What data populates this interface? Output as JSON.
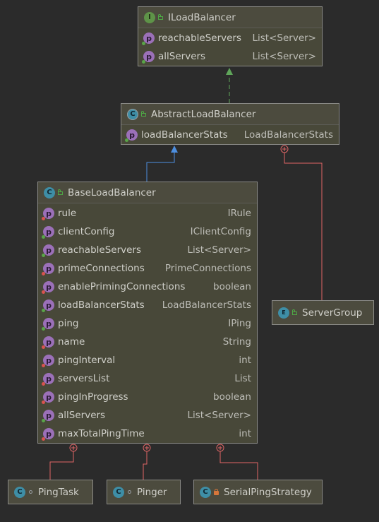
{
  "colors": {
    "background": "#2b2b2b",
    "header": "#4c4b3e",
    "implements_edge": "#5fa55a",
    "extends_edge": "#4d8fe0",
    "inner_edge": "#e06666"
  },
  "boxes": {
    "iloadbalancer": {
      "kind": "interface",
      "icon_letter": "I",
      "visibility": "public",
      "name": "ILoadBalancer",
      "fields": [
        {
          "name": "reachableServers",
          "type": "List<Server>"
        },
        {
          "name": "allServers",
          "type": "List<Server>"
        }
      ]
    },
    "abstractloadbalancer": {
      "kind": "abstract-class",
      "icon_letter": "C",
      "visibility": "public",
      "name": "AbstractLoadBalancer",
      "fields": [
        {
          "name": "loadBalancerStats",
          "type": "LoadBalancerStats"
        }
      ]
    },
    "baseloadbalancer": {
      "kind": "class",
      "icon_letter": "C",
      "visibility": "public",
      "name": "BaseLoadBalancer",
      "fields": [
        {
          "name": "rule",
          "type": "IRule"
        },
        {
          "name": "clientConfig",
          "type": "IClientConfig"
        },
        {
          "name": "reachableServers",
          "type": "List<Server>"
        },
        {
          "name": "primeConnections",
          "type": "PrimeConnections"
        },
        {
          "name": "enablePrimingConnections",
          "type": "boolean"
        },
        {
          "name": "loadBalancerStats",
          "type": "LoadBalancerStats"
        },
        {
          "name": "ping",
          "type": "IPing"
        },
        {
          "name": "name",
          "type": "String"
        },
        {
          "name": "pingInterval",
          "type": "int"
        },
        {
          "name": "serversList",
          "type": "List"
        },
        {
          "name": "pingInProgress",
          "type": "boolean"
        },
        {
          "name": "allServers",
          "type": "List<Server>"
        },
        {
          "name": "maxTotalPingTime",
          "type": "int"
        }
      ]
    },
    "servergroup": {
      "kind": "enum",
      "icon_letter": "E",
      "visibility": "public",
      "name": "ServerGroup"
    },
    "pingtask": {
      "kind": "class",
      "icon_letter": "C",
      "visibility": "package",
      "name": "PingTask"
    },
    "pinger": {
      "kind": "class",
      "icon_letter": "C",
      "visibility": "package",
      "name": "Pinger"
    },
    "serialpingstrategy": {
      "kind": "class",
      "icon_letter": "C",
      "visibility": "private",
      "name": "SerialPingStrategy"
    }
  },
  "relations": [
    {
      "from": "abstractloadbalancer",
      "to": "iloadbalancer",
      "type": "implements"
    },
    {
      "from": "baseloadbalancer",
      "to": "abstractloadbalancer",
      "type": "extends"
    },
    {
      "from": "servergroup",
      "to": "abstractloadbalancer",
      "type": "inner"
    },
    {
      "from": "pingtask",
      "to": "baseloadbalancer",
      "type": "inner"
    },
    {
      "from": "pinger",
      "to": "baseloadbalancer",
      "type": "inner"
    },
    {
      "from": "serialpingstrategy",
      "to": "baseloadbalancer",
      "type": "inner"
    }
  ]
}
